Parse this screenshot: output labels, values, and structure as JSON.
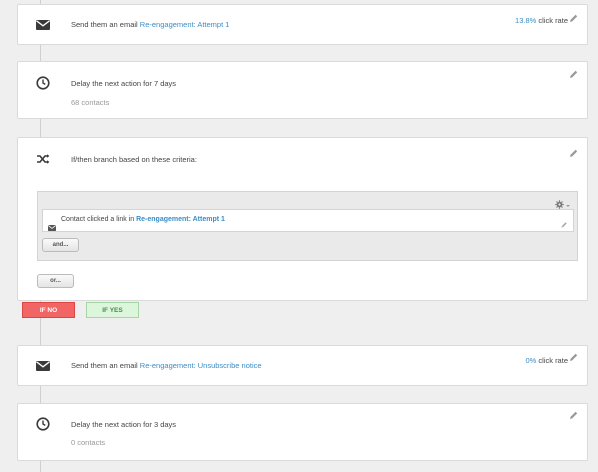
{
  "steps": {
    "email1": {
      "prefix": "Send them an email ",
      "link": "Re-engagement: Attempt 1",
      "rate_pct": "13.8%",
      "rate_label": " click rate"
    },
    "delay1": {
      "text": "Delay the next action for 7 days",
      "contacts": "68 contacts"
    },
    "branch": {
      "title": "If/then branch based on these criteria:",
      "criteria_prefix": "Contact clicked a link in ",
      "criteria_link": "Re-engagement: Attempt 1",
      "and_label": "and...",
      "or_label": "or..."
    },
    "branches": {
      "no_label": "IF NO",
      "yes_label": "IF YES"
    },
    "email2": {
      "prefix": "Send them an email ",
      "link": "Re-engagement: Unsubscribe notice",
      "rate_pct": "0%",
      "rate_label": " click rate"
    },
    "delay2": {
      "text": "Delay the next action for 3 days",
      "contacts": "0 contacts"
    }
  },
  "colors": {
    "link": "#3b8dc7",
    "if_no": "#f26565",
    "if_yes": "#dcf6dc"
  },
  "icons": {
    "email": "envelope-icon",
    "delay": "clock-icon",
    "branch": "shuffle-icon",
    "edit": "pencil-icon",
    "settings": "gear-icon"
  }
}
